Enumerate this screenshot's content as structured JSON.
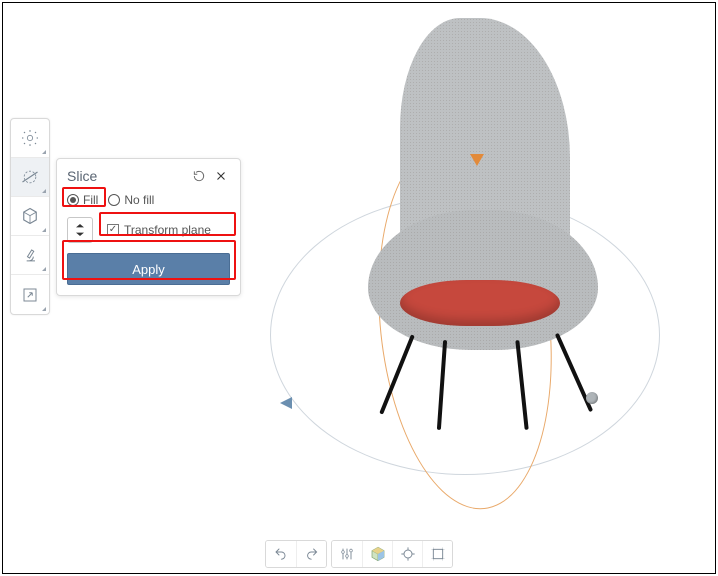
{
  "panel": {
    "title": "Slice",
    "fill_label": "Fill",
    "no_fill_label": "No fill",
    "fill_selected": "fill",
    "transform_plane_label": "Transform plane",
    "transform_plane_checked": true,
    "apply_label": "Apply"
  },
  "left_toolbar": {
    "items": [
      {
        "name": "settings",
        "icon": "gear"
      },
      {
        "name": "slice",
        "icon": "gear-cut",
        "active": true
      },
      {
        "name": "mesh",
        "icon": "hexagon"
      },
      {
        "name": "inspect",
        "icon": "microscope"
      },
      {
        "name": "export",
        "icon": "window-arrow"
      }
    ]
  },
  "bottom_toolbar": {
    "undo": "undo",
    "redo": "redo",
    "sliders": "sliders",
    "view_cube": "view-cube",
    "center": "center",
    "frame": "frame"
  }
}
